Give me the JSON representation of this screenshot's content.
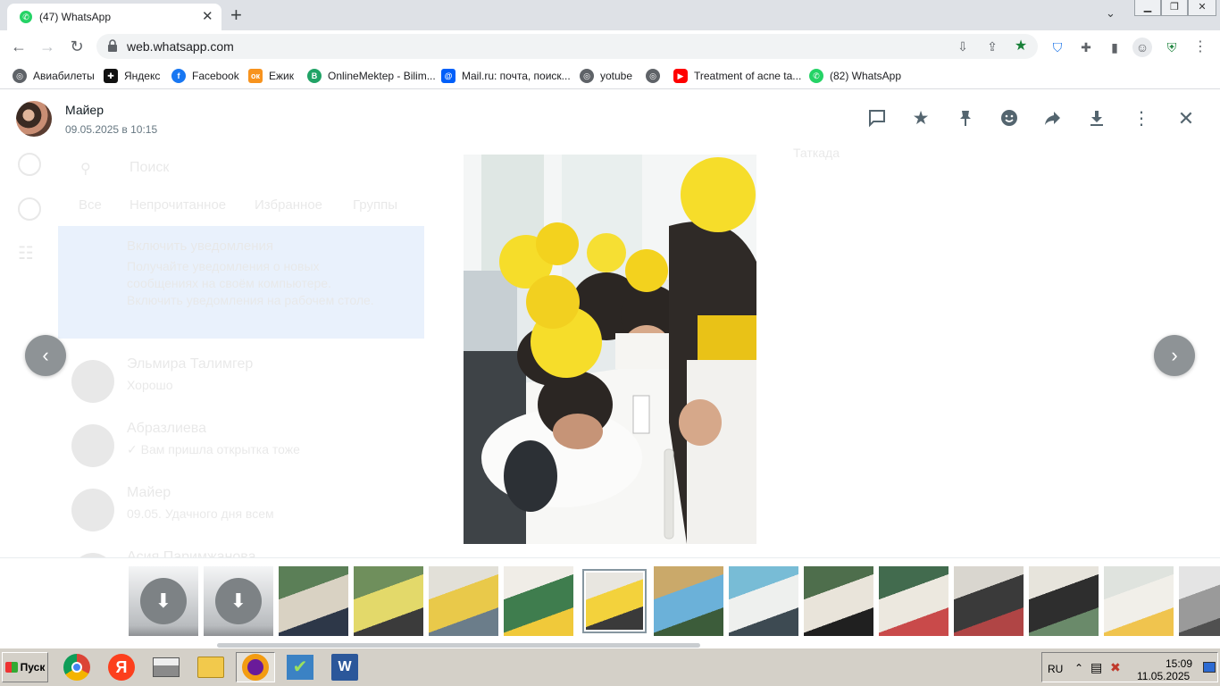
{
  "browser": {
    "tab_title": "(47) WhatsApp",
    "url": "web.whatsapp.com",
    "bookmarks": [
      {
        "label": "Авиабилеты",
        "icon": "globe-icon",
        "color": "#5f6368"
      },
      {
        "label": "Яндекс",
        "icon": "yandex-icon",
        "color": "#111111"
      },
      {
        "label": "Facebook",
        "icon": "facebook-icon",
        "color": "#1877f2"
      },
      {
        "label": "Ежик",
        "icon": "odnoklassniki-icon",
        "color": "#f7931e"
      },
      {
        "label": "OnlineMektep - Bilim...",
        "icon": "onlinemektep-icon",
        "color": "#21a366"
      },
      {
        "label": "Mail.ru: почта, поиск...",
        "icon": "mailru-icon",
        "color": "#005ff9"
      },
      {
        "label": "yotube",
        "icon": "globe-icon",
        "color": "#5f6368"
      },
      {
        "label": "",
        "icon": "globe-icon",
        "color": "#5f6368"
      },
      {
        "label": "Treatment of acne ta...",
        "icon": "youtube-icon",
        "color": "#ff0000"
      },
      {
        "label": "(82) WhatsApp",
        "icon": "whatsapp-icon",
        "color": "#25d366"
      }
    ]
  },
  "viewer": {
    "sender_name": "Майер",
    "sent_at": "09.05.2025 в 10:15",
    "header_icons": [
      "message-icon",
      "star-icon",
      "pin-icon",
      "emoji-icon",
      "forward-icon",
      "download-icon",
      "more-options-icon",
      "close-icon"
    ],
    "thumbnails": [
      {
        "kind": "download"
      },
      {
        "kind": "download"
      },
      {
        "kind": "photo",
        "colors": [
          "#5b7f57",
          "#d9d2c3",
          "#2d3748"
        ]
      },
      {
        "kind": "photo",
        "colors": [
          "#6f8f5c",
          "#e3d96a",
          "#3b3b3b"
        ]
      },
      {
        "kind": "photo",
        "colors": [
          "#e2e0d8",
          "#e9c94a",
          "#6b7d8a"
        ]
      },
      {
        "kind": "photo",
        "colors": [
          "#f0ede7",
          "#3f7d4e",
          "#f0c93a"
        ]
      },
      {
        "kind": "photo",
        "colors": [
          "#e8e6e0",
          "#f3d23c",
          "#3a3a3a"
        ],
        "active": true
      },
      {
        "kind": "photo",
        "colors": [
          "#caa96a",
          "#6bb1d9",
          "#3c5c3a"
        ]
      },
      {
        "kind": "photo",
        "colors": [
          "#78bcd6",
          "#eef0ee",
          "#3d4a52"
        ]
      },
      {
        "kind": "photo",
        "colors": [
          "#4e6e4c",
          "#e9e4da",
          "#202020"
        ]
      },
      {
        "kind": "photo",
        "colors": [
          "#426b4e",
          "#ece8df",
          "#c94a4a"
        ]
      },
      {
        "kind": "photo",
        "colors": [
          "#d9d6cf",
          "#3a3a3a",
          "#b04545"
        ]
      },
      {
        "kind": "photo",
        "colors": [
          "#e7e4dc",
          "#2e2e2e",
          "#6a8a6a"
        ]
      },
      {
        "kind": "photo",
        "colors": [
          "#dfe3de",
          "#f1efe9",
          "#f0c44e"
        ]
      },
      {
        "kind": "photo",
        "colors": [
          "#e4e4e4",
          "#9a9a9a",
          "#505050"
        ]
      }
    ]
  },
  "background_chats": {
    "search_placeholder": "Поиск",
    "filters": [
      "Все",
      "Непрочитанное",
      "Избранное",
      "Группы"
    ],
    "notice_title": "Включить уведомления",
    "notice_body": "Получайте уведомления о новых сообщениях на своём компьютере. Включить уведомления на рабочем столе.",
    "chats": [
      {
        "name": "Эльмира Талимгер",
        "preview": "Хорошо"
      },
      {
        "name": "Абразлиева",
        "preview": "✓ Вам пришла открытка тоже"
      },
      {
        "name": "Майер",
        "preview": "09.05. Удачного дня всем"
      },
      {
        "name": "Асия Паримжанова",
        "preview": ""
      }
    ],
    "side_label": "Таткада"
  },
  "taskbar": {
    "start_label": "Пуск",
    "language": "RU",
    "time": "15:09",
    "date": "11.05.2025",
    "apps": [
      "chrome-icon",
      "yandex-browser-icon",
      "printer-icon",
      "folder-icon",
      "opera-icon",
      "checkmark-app-icon",
      "word-icon"
    ]
  }
}
